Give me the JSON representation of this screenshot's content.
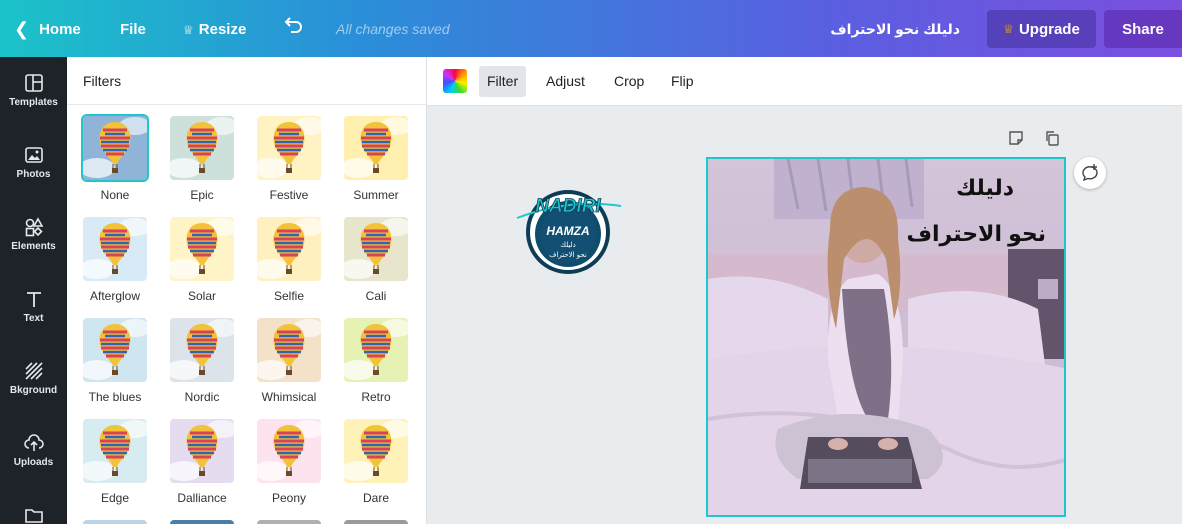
{
  "topbar": {
    "home_label": "Home",
    "file_label": "File",
    "resize_label": "Resize",
    "saved_status": "All changes saved",
    "design_title": "دليلك نحو الاحتراف",
    "upgrade_label": "Upgrade",
    "share_label": "Share"
  },
  "rail": {
    "items": [
      {
        "label": "Templates",
        "icon": "templates-icon"
      },
      {
        "label": "Photos",
        "icon": "photos-icon"
      },
      {
        "label": "Elements",
        "icon": "elements-icon"
      },
      {
        "label": "Text",
        "icon": "text-icon"
      },
      {
        "label": "Bkground",
        "icon": "background-icon"
      },
      {
        "label": "Uploads",
        "icon": "uploads-icon"
      },
      {
        "label": "",
        "icon": "folder-icon"
      }
    ]
  },
  "panel": {
    "title": "Filters",
    "filters": [
      {
        "label": "None",
        "tint": "#8fb4d8",
        "selected": true
      },
      {
        "label": "Epic",
        "tint": "#cde0dc"
      },
      {
        "label": "Festive",
        "tint": "#fff3c4"
      },
      {
        "label": "Summer",
        "tint": "#fff0b0"
      },
      {
        "label": "Afterglow",
        "tint": "#d8eaf6"
      },
      {
        "label": "Solar",
        "tint": "#fff4c8"
      },
      {
        "label": "Selfie",
        "tint": "#fff0c0"
      },
      {
        "label": "Cali",
        "tint": "#e7e5cc"
      },
      {
        "label": "The blues",
        "tint": "#cfe5ef"
      },
      {
        "label": "Nordic",
        "tint": "#dde3ea"
      },
      {
        "label": "Whimsical",
        "tint": "#f3e1c8"
      },
      {
        "label": "Retro",
        "tint": "#e6f2b4"
      },
      {
        "label": "Edge",
        "tint": "#d7ecf1"
      },
      {
        "label": "Dalliance",
        "tint": "#e5dcf0"
      },
      {
        "label": "Peony",
        "tint": "#fde3ef"
      },
      {
        "label": "Dare",
        "tint": "#fff2b8"
      }
    ]
  },
  "toolbar": {
    "filter_label": "Filter",
    "adjust_label": "Adjust",
    "crop_label": "Crop",
    "flip_label": "Flip"
  },
  "canvas": {
    "logo_line1": "NADIRI",
    "logo_line2": "HAMZA",
    "logo_line3": "دليلك",
    "logo_line4": "نحو الاحتراف",
    "design_line1": "دليلك",
    "design_line2": "نحو الاحتراف"
  },
  "colors": {
    "accent": "#1fc6cd",
    "rail_bg": "#1e2229",
    "upgrade_crown": "#f7b500"
  }
}
